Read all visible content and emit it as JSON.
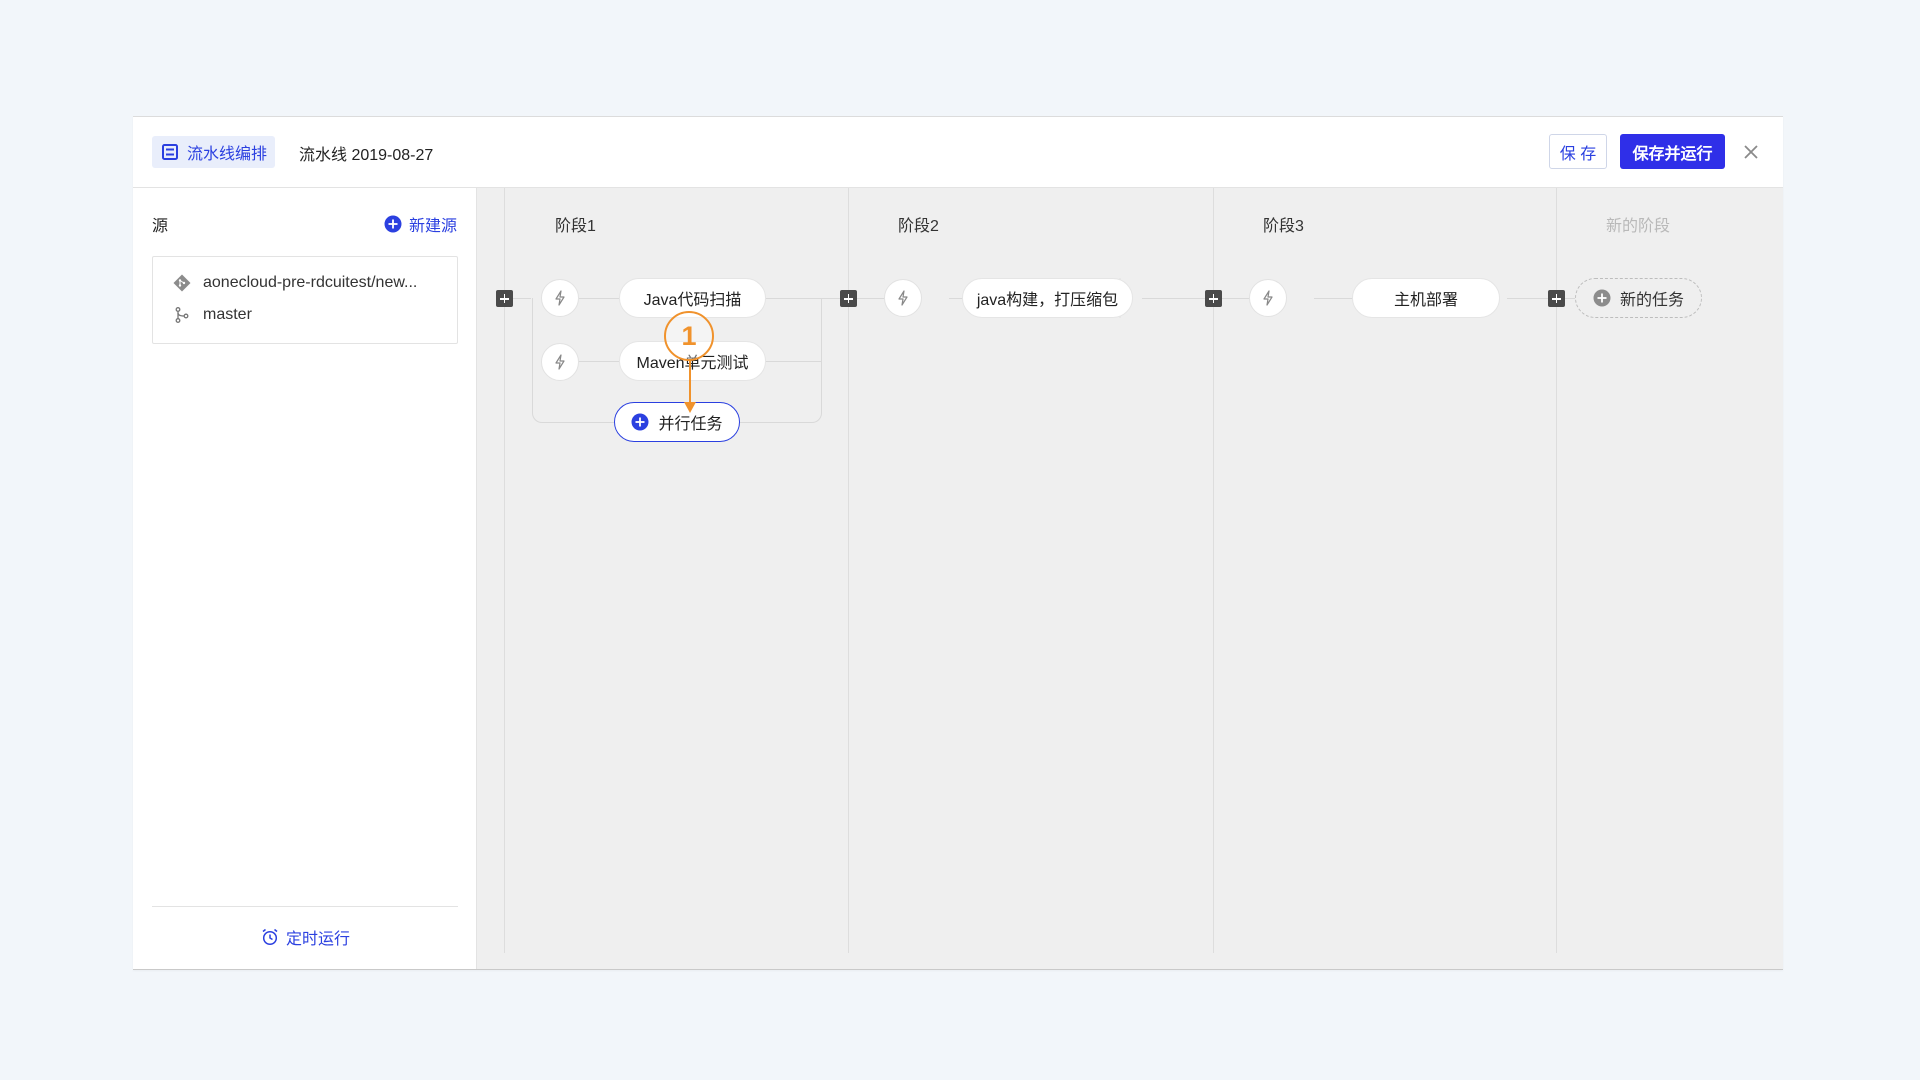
{
  "header": {
    "tab_label": "流水线编排",
    "pipeline_name": "流水线 2019-08-27",
    "save_label": "保 存",
    "save_run_label": "保存并运行"
  },
  "sidebar": {
    "title": "源",
    "new_source_label": "新建源",
    "source": {
      "repo": "aonecloud-pre-rdcuitest/new...",
      "branch": "master"
    },
    "timer_label": "定时运行"
  },
  "stages": [
    {
      "title": "阶段1",
      "tasks": [
        "Java代码扫描",
        "Maven单元测试"
      ],
      "parallel_task_label": "并行任务"
    },
    {
      "title": "阶段2",
      "tasks": [
        "java构建，打压缩包"
      ]
    },
    {
      "title": "阶段3",
      "tasks": [
        "主机部署"
      ]
    },
    {
      "title": "新的阶段",
      "tasks": [
        "新的任务"
      ]
    }
  ],
  "annotation": {
    "number": "1",
    "color": "#f0922c"
  },
  "colors": {
    "accent": "#2b40e0",
    "primary_button": "#2f2fe8"
  }
}
